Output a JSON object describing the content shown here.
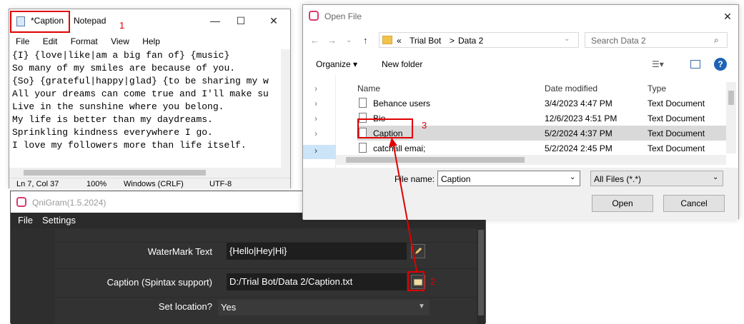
{
  "notepad": {
    "title_modified": "*Caption",
    "title_app": "Notepad",
    "menu": [
      "File",
      "Edit",
      "Format",
      "View",
      "Help"
    ],
    "lines": [
      "{I} {love|like|am a big fan of} {music}",
      "So many of my smiles are because of you.",
      "{So} {grateful|happy|glad} {to be sharing my w",
      "All your dreams can come true and I'll make su",
      "Live in the sunshine where you belong.",
      "My life is better than my daydreams.",
      "Sprinkling kindness everywhere I go.",
      "I love my followers more than life itself."
    ],
    "status": {
      "pos": "Ln 7, Col 37",
      "zoom": "100%",
      "eol": "Windows (CRLF)",
      "enc": "UTF-8"
    }
  },
  "qnigram": {
    "title": "QniGram(1.5.2024)",
    "menu": [
      "File",
      "Settings"
    ],
    "watermark_label": "WaterMark Text",
    "watermark_value": "{Hello|Hey|Hi}",
    "caption_label": "Caption (Spintax support)",
    "caption_value": "D:/Trial Bot/Data 2/Caption.txt",
    "location_label": "Set location?",
    "location_value": "Yes"
  },
  "dialog": {
    "title": "Open File",
    "path": [
      "«",
      "Trial Bot",
      ">",
      "Data 2"
    ],
    "search_placeholder": "Search Data 2",
    "organize": "Organize ▾",
    "new_folder": "New folder",
    "columns": {
      "name": "Name",
      "date": "Date modified",
      "type": "Type"
    },
    "files": [
      {
        "name": "Behance users",
        "date": "3/4/2023 4:47 PM",
        "type": "Text Document"
      },
      {
        "name": "Bio",
        "date": "12/6/2023 4:51 PM",
        "type": "Text Document"
      },
      {
        "name": "Caption",
        "date": "5/2/2024 4:37 PM",
        "type": "Text Document"
      },
      {
        "name": "catchall emai;",
        "date": "5/2/2024 2:45 PM",
        "type": "Text Document"
      }
    ],
    "filename_label": "File name:",
    "filename_value": "Caption",
    "filetype_value": "All Files (*.*)",
    "open": "Open",
    "cancel": "Cancel"
  },
  "annotations": {
    "n1": "1",
    "n2": "2",
    "n3": "3"
  },
  "colors": {
    "annotation_red": "#e00000",
    "dark_panel": "#323232",
    "selection": "#d9d9d9"
  }
}
